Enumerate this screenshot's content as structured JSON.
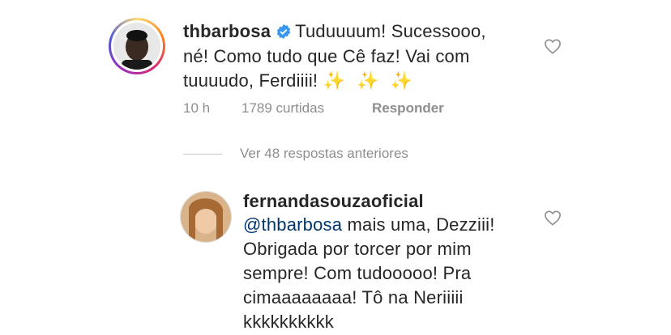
{
  "comment1": {
    "username": "thbarbosa",
    "verified": true,
    "text_line1": "Tuduuuum! Sucessooo,",
    "text_line2": "né! Como tudo que Cê faz! Vai com",
    "text_line3": "tuuuudo, Ferdiiii!",
    "emoji": "✨ ✨ ✨",
    "time": "10 h",
    "likes": "1789 curtidas",
    "reply_label": "Responder"
  },
  "view_replies": "Ver 48 respostas anteriores",
  "comment2": {
    "username": "fernandasouzaoficial",
    "mention": "@thbarbosa",
    "text_line1": " mais uma, Dezziii!",
    "text_line2": "Obrigada por torcer por mim",
    "text_line3": "sempre! Com tudooooo! Pra",
    "text_line4": "cimaaaaaaaa! Tô na Neriiiii",
    "text_line5": "kkkkkkkkkk"
  },
  "colors": {
    "mention": "#00376b",
    "verified": "#3897f0",
    "meta": "#8e8e8e"
  }
}
